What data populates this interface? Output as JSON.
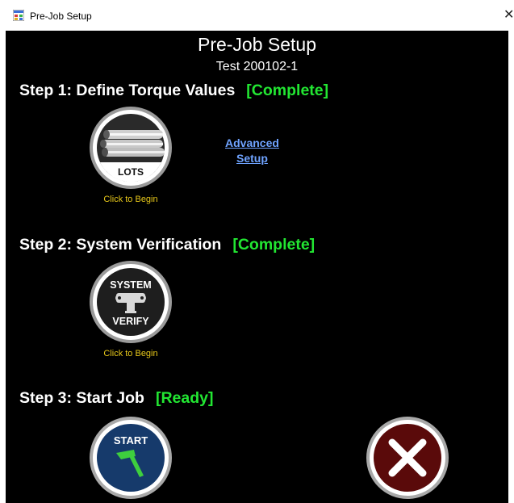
{
  "window": {
    "title": "Pre-Job Setup",
    "close_glyph": "✕",
    "app_icon": "form-app-icon"
  },
  "header": {
    "title": "Pre-Job Setup",
    "subtitle": "Test 200102-1"
  },
  "steps": [
    {
      "label": "Step 1: Define Torque Values",
      "status": "[Complete]",
      "button_text": "LOTS",
      "button_icon": "pipes-icon",
      "caption": "Click to Begin",
      "link": {
        "line1": "Advanced",
        "line2": "Setup"
      }
    },
    {
      "label": "Step 2: System Verification",
      "status": "[Complete]",
      "button_text_top": "SYSTEM",
      "button_text_bottom": "VERIFY",
      "button_icon": "torque-fixture-icon",
      "caption": "Click to Begin"
    },
    {
      "label": "Step 3: Start Job",
      "status": "[Ready]",
      "button_text": "START",
      "button_icon": "hammer-icon"
    }
  ],
  "cancel": {
    "icon": "close-icon"
  },
  "colors": {
    "background": "#000000",
    "status_green": "#22e632",
    "caption_yellow": "#e8c81a",
    "link_blue": "#6fa3ff",
    "start_blue": "#163a6b",
    "cancel_maroon": "#5a0a0a"
  }
}
